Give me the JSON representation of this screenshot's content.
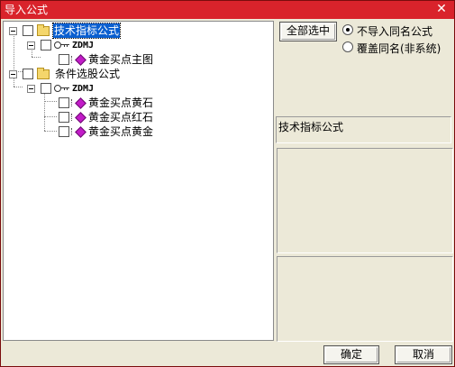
{
  "window": {
    "title": "导入公式"
  },
  "tree": {
    "root1": {
      "label": "技术指标公式",
      "child": {
        "label": "ZDMJ",
        "items": [
          "黄金买点主图"
        ]
      }
    },
    "root2": {
      "label": "条件选股公式",
      "child": {
        "label": "ZDMJ",
        "items": [
          "黄金买点黄石",
          "黄金买点红石",
          "黄金买点黄金"
        ]
      }
    }
  },
  "controls": {
    "select_all": "全部选中",
    "radio_no_import": "不导入同名公式",
    "radio_overwrite": "覆盖同名(非系统)",
    "info_label": "技术指标公式",
    "ok": "确定",
    "cancel": "取消"
  },
  "icons": {
    "folder": "folder-icon",
    "key": "key-icon",
    "formula": "formula-icon",
    "close": "close-icon"
  },
  "colors": {
    "titlebar": "#d9232b",
    "selection": "#0a5fd0",
    "formula_gem": "#c21cc8"
  }
}
